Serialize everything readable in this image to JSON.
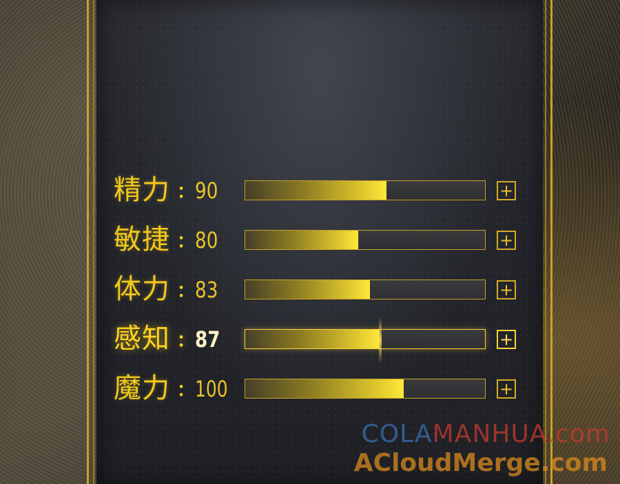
{
  "stats": [
    {
      "name": "精力",
      "colon": ":",
      "value": "90",
      "level": 0.59
    },
    {
      "name": "敏捷",
      "colon": ":",
      "value": "80",
      "level": 0.47
    },
    {
      "name": "体力",
      "colon": ":",
      "value": "83",
      "level": 0.52
    },
    {
      "name": "感知",
      "colon": ":",
      "value": "87",
      "level": 0.56
    },
    {
      "name": "魔力",
      "colon": ":",
      "value": "100",
      "level": 0.66
    }
  ],
  "highlighted_stat": "感知",
  "add_button_label": "+",
  "watermark": {
    "part1": "COLA",
    "part2": "MANHUA.com",
    "line2": "ACloudMerge.com"
  },
  "colors": {
    "gold": "#f2c81d",
    "panel": "#24262c",
    "frame": "#c9a227"
  }
}
